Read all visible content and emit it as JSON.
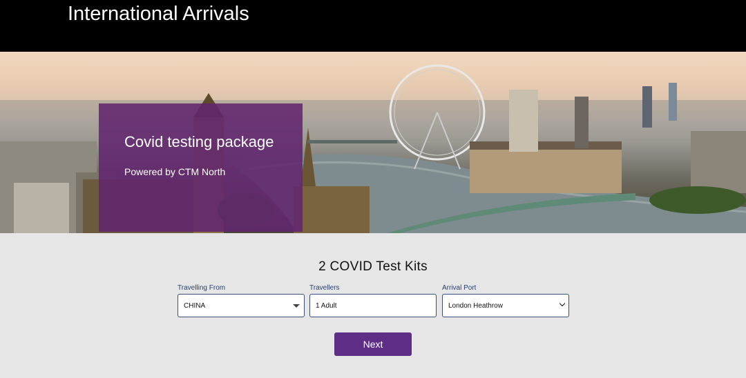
{
  "header": {
    "title": "International Arrivals"
  },
  "hero": {
    "card_title": "Covid testing package",
    "card_subtitle": "Powered by CTM North"
  },
  "form": {
    "heading": "2 COVID Test Kits",
    "travelling_from": {
      "label": "Travelling From",
      "value": "CHINA"
    },
    "travellers": {
      "label": "Travellers",
      "value": "1 Adult"
    },
    "arrival_port": {
      "label": "Arrival Port",
      "value": "London Heathrow"
    },
    "next_label": "Next"
  },
  "colors": {
    "header_bg": "#000000",
    "card_bg": "#62256e",
    "button_bg": "#5e2d86",
    "page_bg": "#e6e6e6"
  }
}
